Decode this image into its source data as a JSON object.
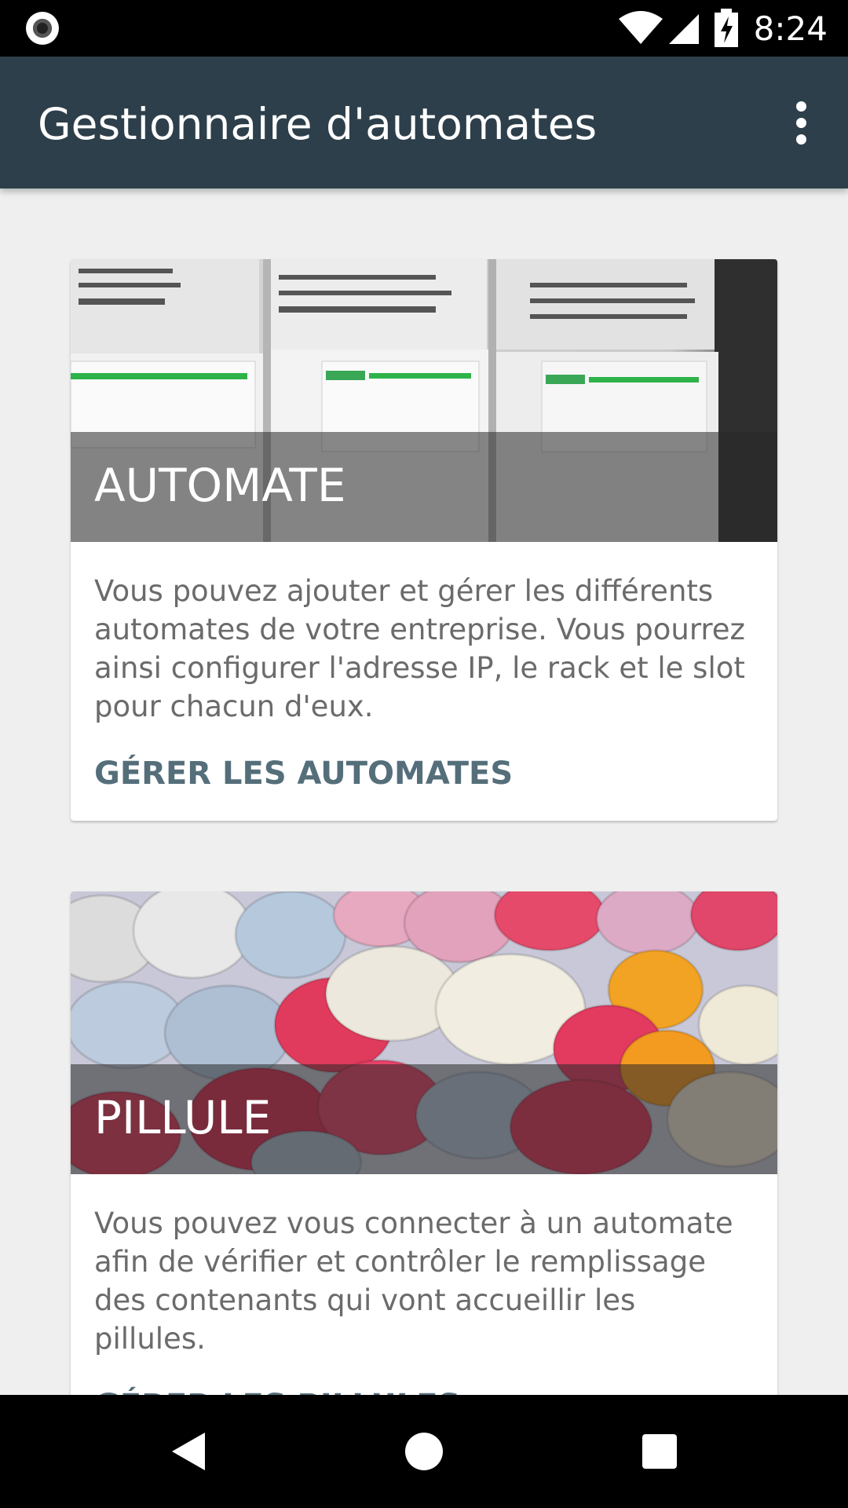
{
  "status_bar": {
    "time": "8:24",
    "icons": [
      "record-icon",
      "wifi-icon",
      "signal-icon",
      "battery-charging-icon"
    ]
  },
  "app_bar": {
    "title": "Gestionnaire d'automates",
    "menu_icon": "overflow-menu-icon"
  },
  "cards": [
    {
      "title": "AUTOMATE",
      "image": "plc-modules-photo",
      "description": "Vous pouvez ajouter et gérer les différents automates de votre entreprise. Vous pourrez ainsi configurer l'adresse IP, le rack et le slot pour chacun d'eux.",
      "action": "GÉRER LES AUTOMATES"
    },
    {
      "title": "PILLULE",
      "image": "pills-photo",
      "description": "Vous pouvez vous connecter à un automate afin de vérifier et contrôler le remplissage des contenants qui vont accueillir les pillules.",
      "action": "GÉRER LES PILLULES"
    }
  ],
  "nav_bar": {
    "back_icon": "back-icon",
    "home_icon": "home-icon",
    "recents_icon": "recents-icon"
  },
  "colors": {
    "app_bar": "#2d3f4a",
    "background": "#efefef",
    "action_text": "#546e7a"
  }
}
